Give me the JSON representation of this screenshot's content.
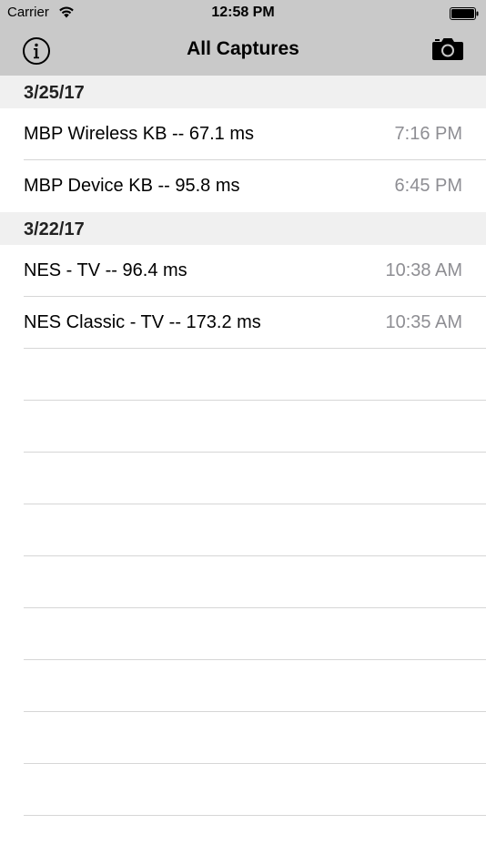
{
  "status_bar": {
    "carrier": "Carrier",
    "time": "12:58 PM"
  },
  "nav": {
    "title": "All Captures",
    "left_icon": "info-icon",
    "right_icon": "camera-icon"
  },
  "sections": [
    {
      "date": "3/25/17",
      "rows": [
        {
          "title": "MBP Wireless KB -- 67.1 ms",
          "time": "7:16 PM"
        },
        {
          "title": "MBP Device KB -- 95.8 ms",
          "time": "6:45 PM"
        }
      ]
    },
    {
      "date": "3/22/17",
      "rows": [
        {
          "title": "NES - TV -- 96.4 ms",
          "time": "10:38 AM"
        },
        {
          "title": "NES Classic - TV -- 173.2 ms",
          "time": "10:35 AM"
        }
      ]
    }
  ],
  "colors": {
    "nav_background": "#c9c9c9",
    "section_background": "#f0f0f0",
    "secondary_text": "#8e8e93"
  }
}
